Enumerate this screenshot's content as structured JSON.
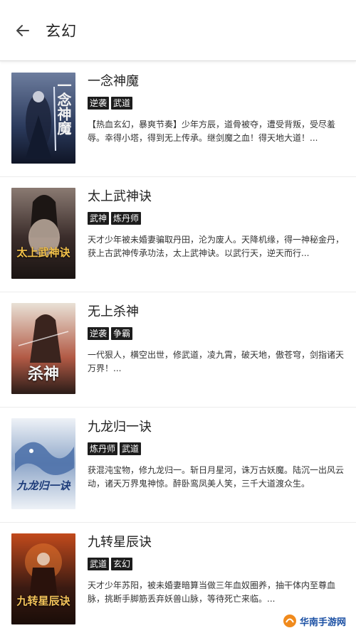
{
  "header": {
    "title": "玄幻",
    "back_icon": "arrow-left-icon"
  },
  "books": [
    {
      "title": "一念神魔",
      "tags": [
        "逆袭",
        "武道"
      ],
      "description": "【热血玄幻，暴爽节奏】少年方辰，道骨被夺，遭受背叛，受尽羞辱。幸得小塔，得到无上传承。继剑魔之血！得天地大道！...",
      "cover": {
        "text": "一念神魔",
        "palette": [
          "#2b3a5c",
          "#6d7d9e",
          "#0f1526"
        ]
      }
    },
    {
      "title": "太上武神诀",
      "tags": [
        "武神",
        "炼丹师"
      ],
      "description": "天才少年被未婚妻骗取丹田，沦为废人。天降机缘，得一神秘金丹，获上古武神传承功法，太上武神诀。以武行天，逆天而行...",
      "cover": {
        "text": "太上武神诀",
        "palette": [
          "#3a2c2a",
          "#8a7a72",
          "#1a1412"
        ]
      }
    },
    {
      "title": "无上杀神",
      "tags": [
        "逆袭",
        "争霸"
      ],
      "description": "一代狠人，横空出世，修武道，凌九霄，破天地，傲苍穹，剑指诸天万界！...",
      "cover": {
        "text": "杀神",
        "palette": [
          "#e9e1d6",
          "#b25a45",
          "#2a1c18"
        ]
      }
    },
    {
      "title": "九龙归一诀",
      "tags": [
        "炼丹师",
        "武道"
      ],
      "description": "获混沌宝物，修九龙归一。斩日月星河，诛万古妖魔。陆沉一出风云动，诸天万界鬼神惊。醉卧鸾凤美人笑，三千大道渡众生。",
      "cover": {
        "text": "九龙归一诀",
        "palette": [
          "#eef2f7",
          "#4a6fa8",
          "#8fa7c9"
        ]
      }
    },
    {
      "title": "九转星辰诀",
      "tags": [
        "武道",
        "玄幻"
      ],
      "description": "天才少年苏阳，被未婚妻暗算当做三年血奴圈养，抽干体内至尊血脉，挑断手脚筋丢弃妖兽山脉，等待死亡来临。...",
      "cover": {
        "text": "九转星辰诀",
        "palette": [
          "#3a1a12",
          "#c24a1c",
          "#1a0d08"
        ]
      }
    }
  ],
  "watermark": {
    "text": "华南手游网",
    "icon": "logo-icon"
  }
}
